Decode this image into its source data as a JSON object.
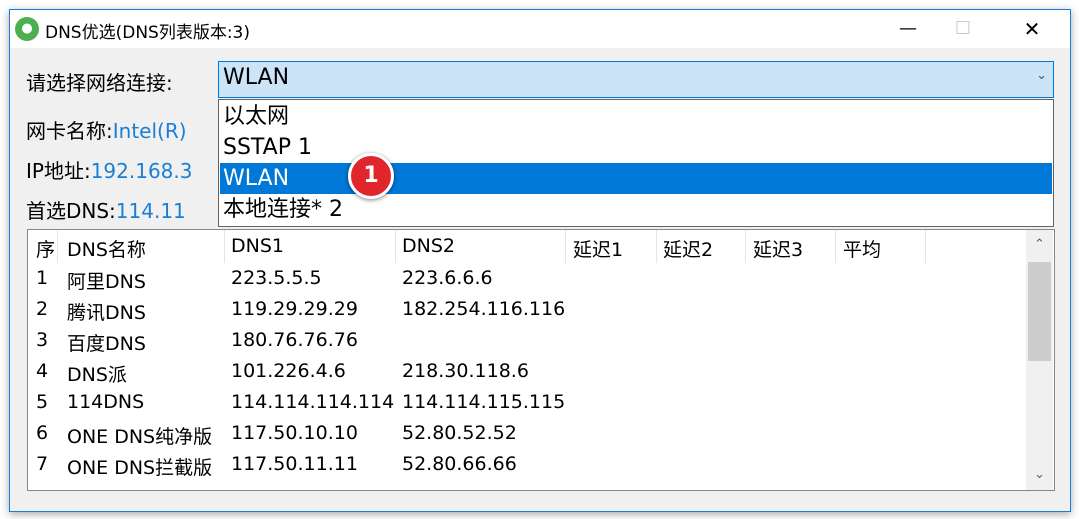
{
  "window": {
    "title": "DNS优选(DNS列表版本:3)",
    "icon": "chat-bubble-icon",
    "controls": {
      "minimize": "—",
      "maximize": "☐",
      "close": "✕"
    }
  },
  "connection": {
    "label": "请选择网络连接:",
    "selected": "WLAN",
    "options": [
      "以太网",
      "SSTAP 1",
      "WLAN",
      "本地连接* 2"
    ],
    "highlighted_index": 2
  },
  "info": {
    "adapter_label": "网卡名称:",
    "adapter_value": "Intel(R)",
    "ip_label": "IP地址:",
    "ip_value": "192.168.3",
    "dns_label": "首选DNS:",
    "dns_value": "114.11"
  },
  "annotation": {
    "badge": "1"
  },
  "table": {
    "headers": [
      "序",
      "DNS名称",
      "DNS1",
      "DNS2",
      "延迟1",
      "延迟2",
      "延迟3",
      "平均"
    ],
    "rows": [
      [
        "1",
        "阿里DNS",
        "223.5.5.5",
        "223.6.6.6"
      ],
      [
        "2",
        "腾讯DNS",
        "119.29.29.29",
        "182.254.116.116"
      ],
      [
        "3",
        "百度DNS",
        "180.76.76.76",
        ""
      ],
      [
        "4",
        "DNS派",
        "101.226.4.6",
        "218.30.118.6"
      ],
      [
        "5",
        "114DNS",
        "114.114.114.114",
        "114.114.115.115"
      ],
      [
        "6",
        "ONE DNS纯净版",
        "117.50.10.10",
        "52.80.52.52"
      ],
      [
        "7",
        "ONE DNS拦截版",
        "117.50.11.11",
        "52.80.66.66"
      ]
    ]
  },
  "colors": {
    "accent": "#0078d7",
    "value_text": "#1a7fd4",
    "badge": "#e0262c"
  }
}
